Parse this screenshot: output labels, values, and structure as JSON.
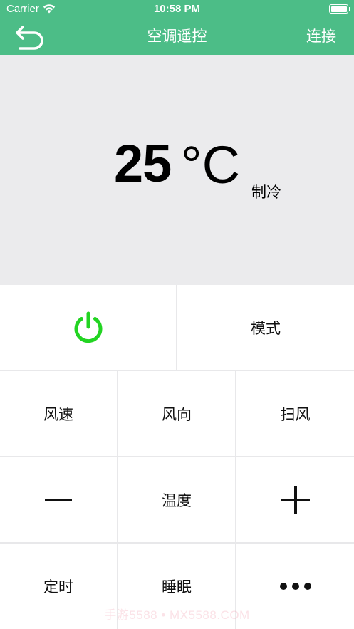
{
  "status_bar": {
    "carrier": "Carrier",
    "wifi_icon": "wifi-icon",
    "time": "10:58 PM",
    "battery_icon": "battery-icon"
  },
  "nav": {
    "back_icon": "undo-arrow-icon",
    "title": "空调遥控",
    "connect_label": "连接",
    "background_color": "#4cbd87"
  },
  "display": {
    "temperature": "25",
    "unit": "°C",
    "mode": "制冷",
    "background_color": "#ebebed"
  },
  "controls": {
    "power_icon": "power-icon",
    "power_color": "#22d422",
    "mode_label": "模式",
    "fan_speed_label": "风速",
    "fan_direction_label": "风向",
    "swing_label": "扫风",
    "temp_down_icon": "minus-icon",
    "temperature_label": "温度",
    "temp_up_icon": "plus-icon",
    "timer_label": "定时",
    "sleep_label": "睡眠",
    "more_icon": "more-dots-icon"
  },
  "watermark": "手游5588 • MX5588.COM"
}
